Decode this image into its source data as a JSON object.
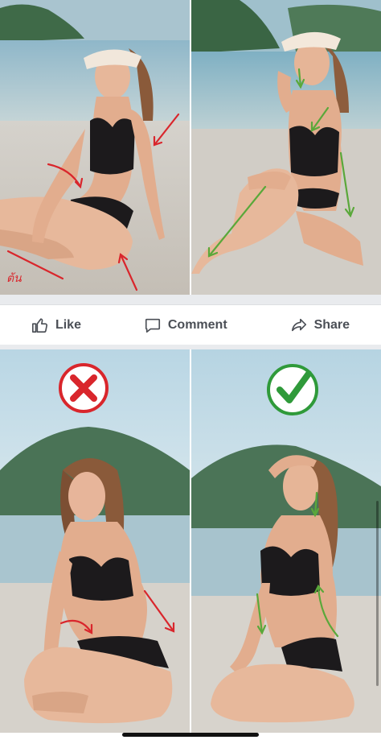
{
  "actions": {
    "like_label": "Like",
    "comment_label": "Comment",
    "share_label": "Share"
  },
  "icons": {
    "like": "thumbs-up-icon",
    "comment": "comment-bubble-icon",
    "share": "share-arrow-icon",
    "wrong": "red-x-mark-icon",
    "right": "green-check-mark-icon"
  },
  "photos": {
    "top_left_watermark": "ต้น"
  },
  "colors": {
    "wrong": "#d9262c",
    "right": "#2f9a3a",
    "annotation_red": "#d9262c",
    "annotation_green": "#5aa83a",
    "action_text": "#4b4f56",
    "divider": "#e9ebee"
  }
}
